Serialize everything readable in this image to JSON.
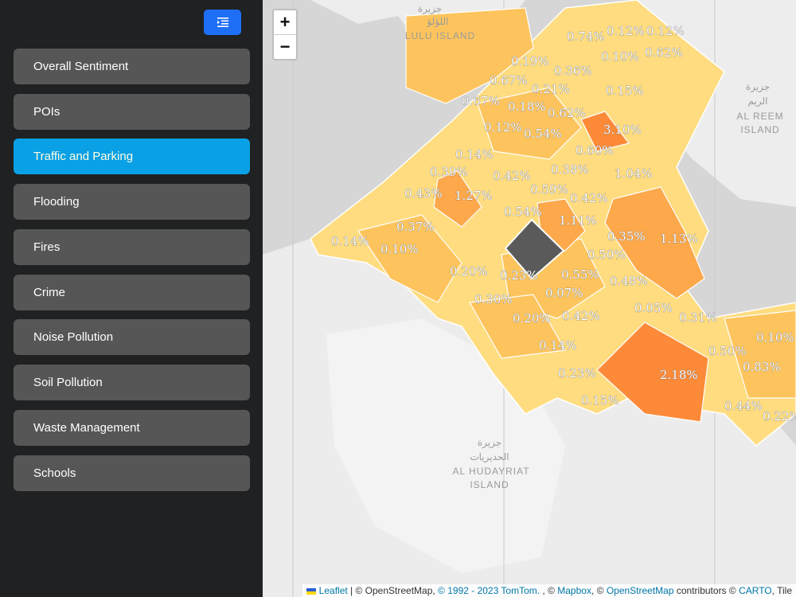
{
  "sidebar": {
    "toggle_icon": "list-indent-icon",
    "items": [
      {
        "label": "Overall Sentiment",
        "active": false
      },
      {
        "label": "POIs",
        "active": false
      },
      {
        "label": "Traffic and Parking",
        "active": true
      },
      {
        "label": "Flooding",
        "active": false
      },
      {
        "label": "Fires",
        "active": false
      },
      {
        "label": "Crime",
        "active": false
      },
      {
        "label": "Noise Pollution",
        "active": false
      },
      {
        "label": "Soil Pollution",
        "active": false
      },
      {
        "label": "Waste Management",
        "active": false
      },
      {
        "label": "Schools",
        "active": false
      }
    ]
  },
  "map": {
    "zoom_in": "+",
    "zoom_out": "−",
    "places": {
      "lulu_ar_1": "جزيرة",
      "lulu_ar_2": "اللؤلؤ",
      "lulu_en": "LULU ISLAND",
      "reem_ar_1": "جزيرة",
      "reem_ar_2": "الريم",
      "reem_en_1": "AL REEM",
      "reem_en_2": "ISLAND",
      "hudayriat_ar_1": "جزيرة",
      "hudayriat_ar_2": "الحديريات",
      "hudayriat_en_1": "AL HUDAYRIAT",
      "hudayriat_en_2": "ISLAND"
    },
    "district_labels": [
      "0.74%",
      "0.12%",
      "0.12%",
      "0.10%",
      "0.62%",
      "0.19%",
      "0.36%",
      "0.67%",
      "0.21%",
      "0.15%",
      "0.67%",
      "0.18%",
      "0.62%",
      "0.12%",
      "0.54%",
      "3.10%",
      "0.14%",
      "0.60%",
      "0.39%",
      "0.42%",
      "0.38%",
      "1.04%",
      "0.43%",
      "1.27%",
      "0.59%",
      "0.42%",
      "0.54%",
      "1.11%",
      "0.37%",
      "0.35%",
      "1.13%",
      "0.14%",
      "0.10%",
      "0.50%",
      "0.20%",
      "0.23%",
      "0.55%",
      "0.48%",
      "0.30%",
      "0.07%",
      "0.05%",
      "0.20%",
      "0.42%",
      "0.31%",
      "0.10%",
      "0.14%",
      "0.50%",
      "0.83%",
      "0.23%",
      "2.18%",
      "0.15%",
      "0.44%",
      "0.22%"
    ],
    "colors": {
      "low": "#fedc7f",
      "mid": "#fdc45d",
      "high": "#fca84b",
      "very_high": "#fc8a38",
      "selected": "#5a5a5a"
    },
    "attribution": {
      "leaflet": "Leaflet",
      "sep1": " | © OpenStreetMap, ",
      "tomtom": "© 1992 - 2023 TomTom.",
      "sep2": " , © ",
      "mapbox": "Mapbox",
      "sep3": ", © ",
      "osm": "OpenStreetMap",
      "sep4": " contributors © ",
      "carto": "CARTO",
      "sep5": ", Tile"
    }
  }
}
